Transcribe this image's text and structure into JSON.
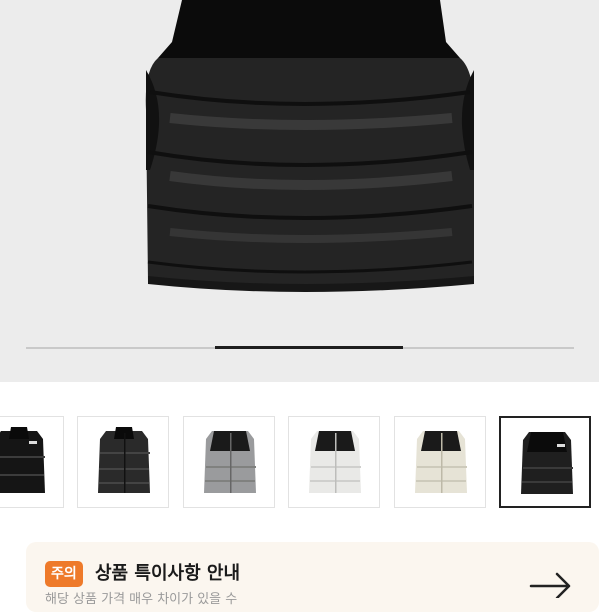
{
  "product_image": {
    "icon": "black-puffer-vest-image"
  },
  "gallery": {
    "current_index": 2,
    "total_slides": 5
  },
  "thumbnails": [
    {
      "color": "black-gloss",
      "hex": "#1a1a1a"
    },
    {
      "color": "black-matte",
      "hex": "#2a2a2a"
    },
    {
      "color": "grey",
      "hex": "#9a9b9d"
    },
    {
      "color": "white",
      "hex": "#e9e9e7"
    },
    {
      "color": "cream",
      "hex": "#e6e3d6"
    },
    {
      "color": "black",
      "hex": "#1f1f1f",
      "selected": true
    }
  ],
  "notice": {
    "badge": "주의",
    "title": "상품 특이사항 안내",
    "subtitle": "해당 상품 가격 매우 차이가 있을 수",
    "arrow_icon": "arrow-right-icon"
  }
}
